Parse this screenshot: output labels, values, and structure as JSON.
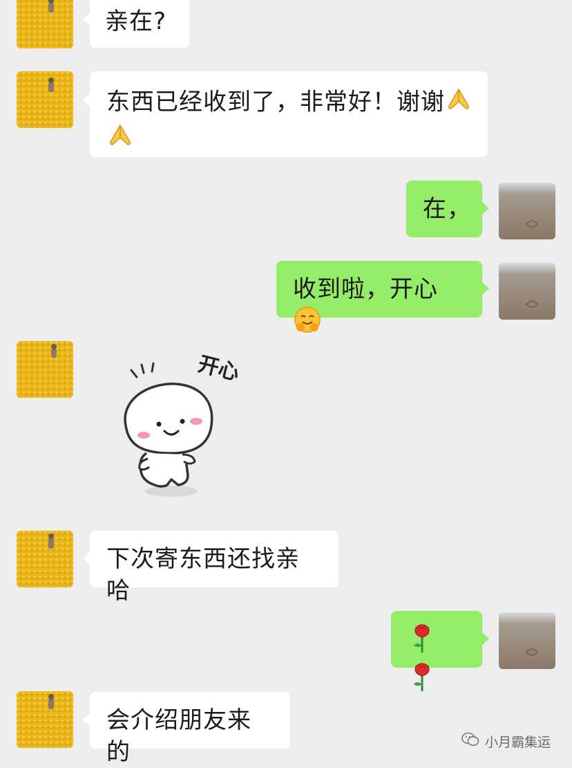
{
  "messages": [
    {
      "side": "left",
      "text": "亲在?"
    },
    {
      "side": "left",
      "text": "东西已经收到了，非常好！谢谢",
      "emojis": [
        "folded-hands",
        "folded-hands"
      ]
    },
    {
      "side": "right",
      "text": "在，"
    },
    {
      "side": "right",
      "text": "收到啦，开心",
      "emojis": [
        "hugging-face"
      ]
    },
    {
      "side": "left",
      "type": "sticker",
      "sticker_text": "开心"
    },
    {
      "side": "left",
      "text": "下次寄东西还找亲哈"
    },
    {
      "side": "right",
      "emojis": [
        "rose",
        "rose"
      ]
    },
    {
      "side": "left",
      "text": "会介绍朋友来的"
    }
  ],
  "watermark": {
    "text": "小月霸集运",
    "icon": "wechat-logo-icon"
  },
  "colors": {
    "background": "#ededed",
    "received_bubble": "#ffffff",
    "sent_bubble": "#95ec69",
    "flower_field": "#e9b81c"
  }
}
